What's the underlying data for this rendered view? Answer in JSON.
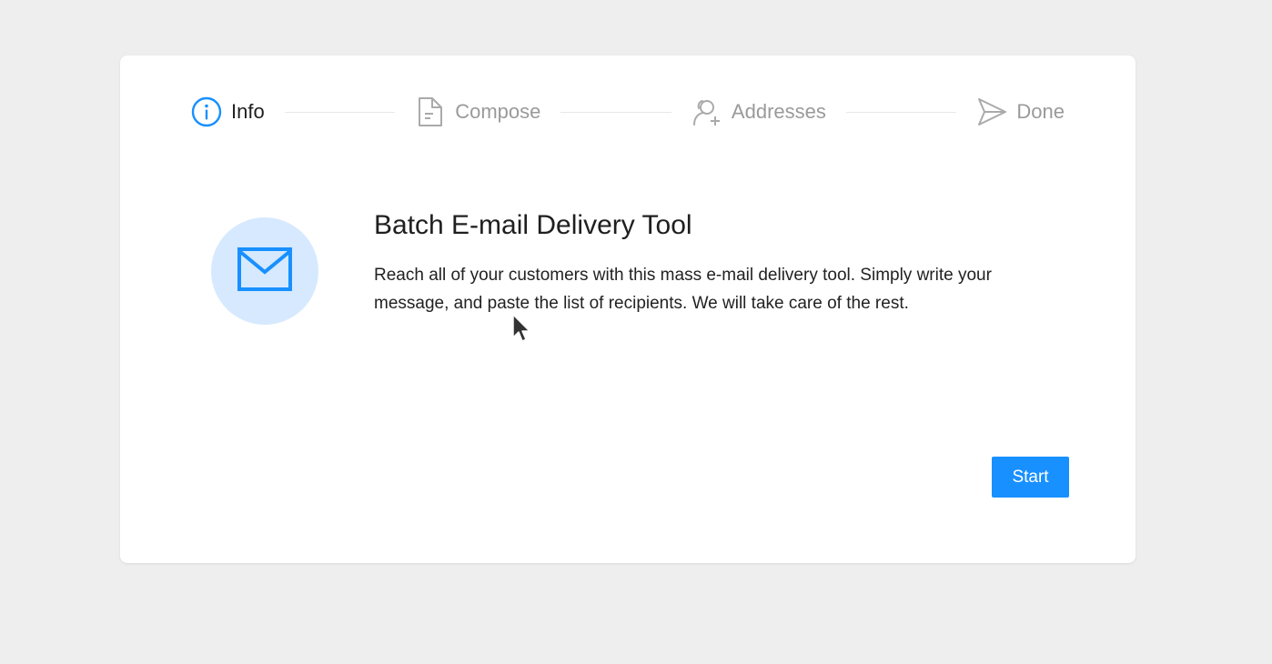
{
  "colors": {
    "accent": "#1890ff",
    "accent_light": "#d6e9ff",
    "inactive": "#9a9a9a",
    "background": "#eeeeee"
  },
  "steps": [
    {
      "label": "Info",
      "icon": "info-circle-icon",
      "active": true
    },
    {
      "label": "Compose",
      "icon": "file-icon",
      "active": false
    },
    {
      "label": "Addresses",
      "icon": "user-add-icon",
      "active": false
    },
    {
      "label": "Done",
      "icon": "send-icon",
      "active": false
    }
  ],
  "hero": {
    "icon": "mail-icon",
    "title": "Batch E-mail Delivery Tool",
    "description": "Reach all of your customers with this mass e-mail delivery tool. Simply write your message, and paste the list of recipients. We will take care of the rest."
  },
  "actions": {
    "start_label": "Start"
  }
}
